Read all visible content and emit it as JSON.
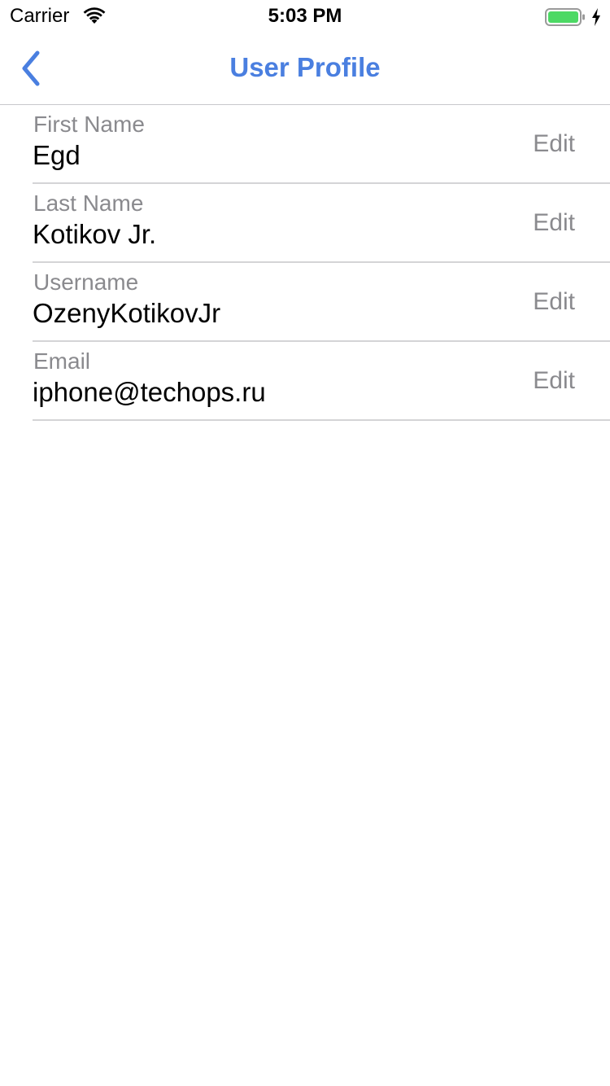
{
  "status_bar": {
    "carrier": "Carrier",
    "time": "5:03 PM",
    "battery_level": 1.0,
    "battery_color": "#4cd964"
  },
  "nav": {
    "title": "User Profile",
    "accent_color": "#4a7fe0",
    "back_icon": "chevron-left-icon"
  },
  "fields": [
    {
      "label": "First Name",
      "value": "Egd",
      "action": "Edit"
    },
    {
      "label": "Last Name",
      "value": "Kotikov Jr.",
      "action": "Edit"
    },
    {
      "label": "Username",
      "value": "OzenyKotikovJr",
      "action": "Edit"
    },
    {
      "label": "Email",
      "value": "iphone@techops.ru",
      "action": "Edit"
    }
  ]
}
